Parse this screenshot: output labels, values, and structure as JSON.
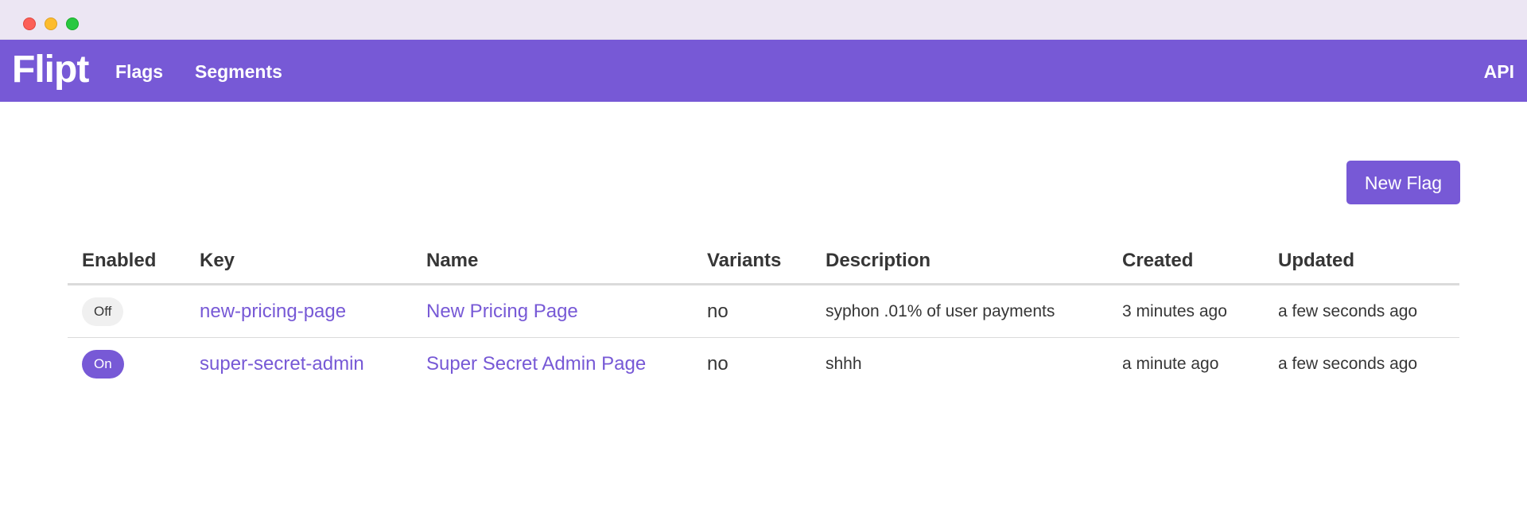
{
  "navbar": {
    "brand": "Flipt",
    "links": [
      {
        "label": "Flags"
      },
      {
        "label": "Segments"
      }
    ],
    "api_label": "API"
  },
  "actions": {
    "new_flag_label": "New Flag"
  },
  "table": {
    "headers": [
      "Enabled",
      "Key",
      "Name",
      "Variants",
      "Description",
      "Created",
      "Updated"
    ],
    "rows": [
      {
        "enabled": "Off",
        "key": "new-pricing-page",
        "name": "New Pricing Page",
        "variants": "no",
        "description": "syphon .01% of user payments",
        "created": "3 minutes ago",
        "updated": "a few seconds ago"
      },
      {
        "enabled": "On",
        "key": "super-secret-admin",
        "name": "Super Secret Admin Page",
        "variants": "no",
        "description": "shhh",
        "created": "a minute ago",
        "updated": "a few seconds ago"
      }
    ]
  },
  "colors": {
    "accent": "#7759d6",
    "titlebar": "#ece6f3",
    "tag_off_bg": "#f0f0f0"
  }
}
